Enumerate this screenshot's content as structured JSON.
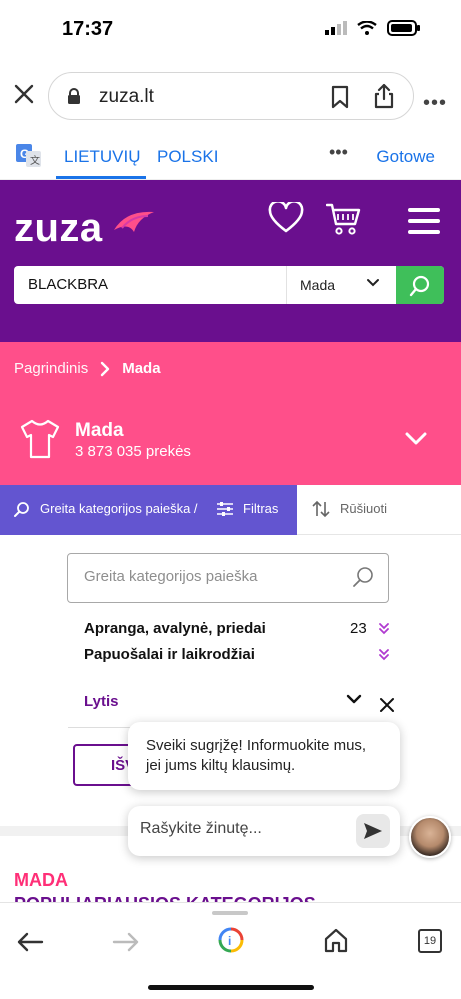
{
  "status": {
    "time": "17:37"
  },
  "browser": {
    "url": "zuza.lt",
    "translate": {
      "lang1": "LIETUVIŲ",
      "lang2": "POLSKI",
      "done": "Gotowe"
    },
    "tab_count": "19"
  },
  "header": {
    "logo": "zuza",
    "search_term": "BLACKBRA",
    "search_category": "Mada"
  },
  "breadcrumb": {
    "home": "Pagrindinis",
    "current": "Mada"
  },
  "category": {
    "title": "Mada",
    "count": "3 873 035 prekės"
  },
  "filters": {
    "quick_search": "Greita kategorijos paieška /",
    "filter": "Filtras",
    "sort": "Rūšiuoti"
  },
  "content": {
    "search_placeholder": "Greita kategorijos paieška",
    "categories": [
      {
        "label": "Apranga, avalynė, priedai",
        "count": "23"
      },
      {
        "label": "Papuošalai ir laikrodžiai",
        "count": ""
      }
    ],
    "gender_label": "Lytis",
    "button_partial": "IŠV",
    "section_label": "MADA",
    "popular_label": "POPULIARIAUSIOS KATEGORIJOS"
  },
  "chat": {
    "message": "Sveiki sugrįžę! Informuokite mus, jei jums kiltų klausimų.",
    "input_placeholder": "Rašykite žinutę..."
  },
  "colors": {
    "purple": "#6a0f8e",
    "pink": "#ff4f8a",
    "green": "#3fbf5a",
    "filter_blue": "#6355d0"
  }
}
